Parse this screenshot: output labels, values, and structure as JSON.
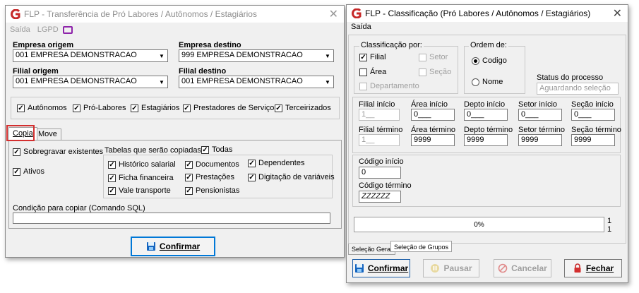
{
  "left_window": {
    "title": "FLP - Transferência de Pró Labores / Autônomos / Estagiários",
    "menu": [
      "Saída",
      "LGPD"
    ],
    "empresa_origem": {
      "label": "Empresa origem",
      "value": "001 EMPRESA DEMONSTRACAO"
    },
    "empresa_destino": {
      "label": "Empresa destino",
      "value": "999 EMPRESA DEMONSTRACAO"
    },
    "filial_origem": {
      "label": "Filial origem",
      "value": "001 EMPRESA DEMONSTRACAO"
    },
    "filial_destino": {
      "label": "Filial destino",
      "value": "001 EMPRESA DEMONSTRACAO"
    },
    "types": [
      "Autônomos",
      "Pró-Labores",
      "Estagiários",
      "Prestadores de Serviços",
      "Terceirizados"
    ],
    "tabs": [
      "Copia",
      "Move"
    ],
    "sobregravar": "Sobregravar existentes",
    "ativos": "Ativos",
    "tabelas_label": "Tabelas que serão copiadas:",
    "todas": "Todas",
    "tables": [
      "Histórico salarial",
      "Documentos",
      "Dependentes",
      "Ficha financeira",
      "Prestações",
      "Digitação de variáveis",
      "Vale transporte",
      "Pensionistas"
    ],
    "sql_label": "Condição para copiar (Comando SQL)",
    "sql_value": "",
    "confirm": "Confirmar"
  },
  "right_window": {
    "title": "FLP - Classificação (Pró Labores / Autônomos / Estagiários)",
    "menu": [
      "Saída"
    ],
    "classificacao_label": "Classificação  por:",
    "class_options": [
      {
        "label": "Filial",
        "checked": true,
        "enabled": true
      },
      {
        "label": "Setor",
        "checked": false,
        "enabled": false
      },
      {
        "label": "Área",
        "checked": false,
        "enabled": true
      },
      {
        "label": "Seção",
        "checked": false,
        "enabled": false
      },
      {
        "label": "Departamento",
        "checked": false,
        "enabled": false
      }
    ],
    "ordem_label": "Ordem de:",
    "ordem_options": [
      {
        "label": "Codigo",
        "selected": true
      },
      {
        "label": "Nome",
        "selected": false
      }
    ],
    "status_label": "Status do processo",
    "status_value": "Aguardando seleção",
    "ranges": [
      {
        "label": "Filial início",
        "value": "1__",
        "enabled": false
      },
      {
        "label": "Área início",
        "value": "0___",
        "enabled": true
      },
      {
        "label": "Depto início",
        "value": "0___",
        "enabled": true
      },
      {
        "label": "Setor início",
        "value": "0___",
        "enabled": true
      },
      {
        "label": "Seção início",
        "value": "0___",
        "enabled": true
      },
      {
        "label": "Filial término",
        "value": "1__",
        "enabled": false
      },
      {
        "label": "Área término",
        "value": "9999",
        "enabled": true
      },
      {
        "label": "Depto término",
        "value": "9999",
        "enabled": true
      },
      {
        "label": "Setor término",
        "value": "9999",
        "enabled": true
      },
      {
        "label": "Seção término",
        "value": "9999",
        "enabled": true
      }
    ],
    "codigo_inicio": {
      "label": "Código início",
      "value": "0"
    },
    "codigo_termino": {
      "label": "Código término",
      "value": "ZZZZZZ"
    },
    "progress": {
      "text": "0%",
      "fraction": 0,
      "count_top": "1",
      "count_bottom": "1"
    },
    "tabs": [
      "Seleção Geral",
      "Seleção de Grupos"
    ],
    "buttons": {
      "confirmar": "Confirmar",
      "pausar": "Pausar",
      "cancelar": "Cancelar",
      "fechar": "Fechar"
    }
  },
  "colors": {
    "accent": "#0078d7",
    "highlight": "#d32f2f",
    "logo_red": "#c62828"
  }
}
